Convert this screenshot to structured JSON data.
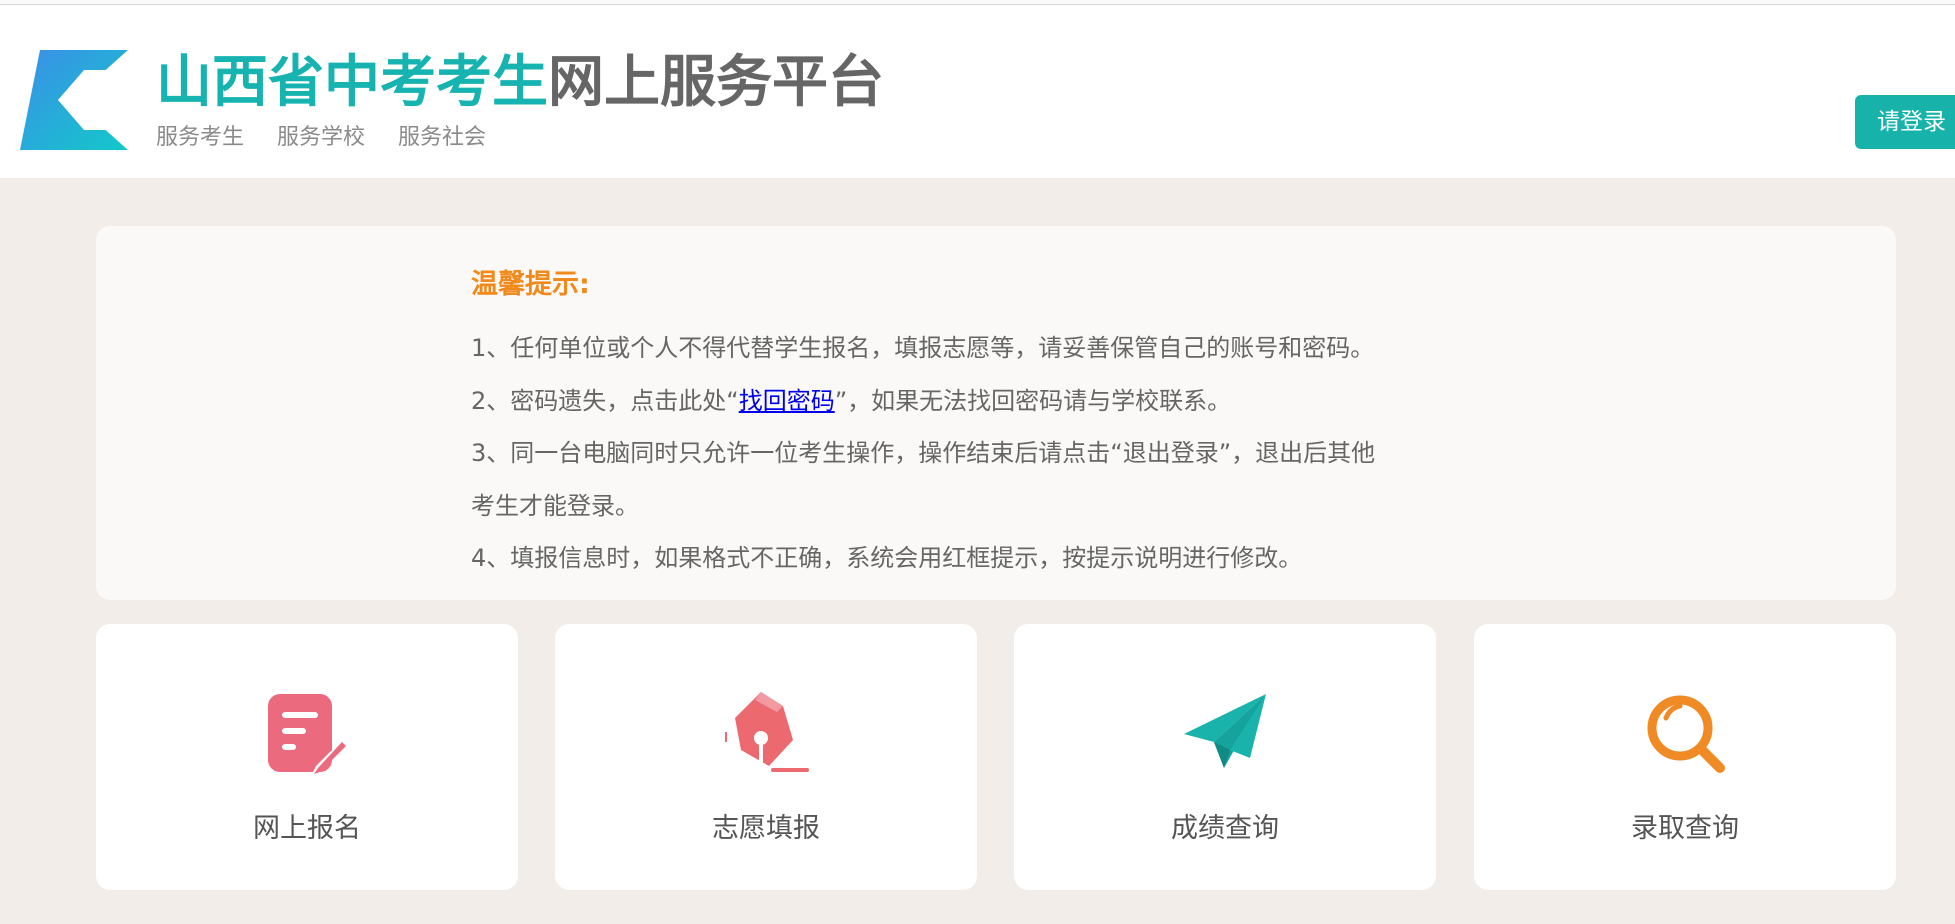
{
  "header": {
    "title_highlight": "山西省中考考生",
    "title_rest": "网上服务平台",
    "slogans": [
      "服务考生",
      "服务学校",
      "服务社会"
    ],
    "login_label": "请登录"
  },
  "notice": {
    "title": "温馨提示:",
    "line1": "1、任何单位或个人不得代替学生报名，填报志愿等，请妥善保管自己的账号和密码。",
    "line2_prefix": "2、密码遗失，点击此处“",
    "line2_link": "找回密码",
    "line2_suffix": "”，如果无法找回密码请与学校联系。",
    "line3": "3、同一台电脑同时只允许一位考生操作，操作结束后请点击“退出登录”，退出后其他",
    "line3_cont": "考生才能登录。",
    "line4": "4、填报信息时，如果格式不正确，系统会用红框提示，按提示说明进行修改。"
  },
  "cards": [
    {
      "label": "网上报名",
      "icon": "registration-form-icon",
      "color": "#ec6a7d"
    },
    {
      "label": "志愿填报",
      "icon": "fountain-pen-icon",
      "color": "#ec6a6f"
    },
    {
      "label": "成绩查询",
      "icon": "paper-plane-icon",
      "color": "#19b3ac"
    },
    {
      "label": "录取查询",
      "icon": "magnifier-icon",
      "color": "#f08a24"
    }
  ],
  "colors": {
    "brand": "#17b3b0",
    "notice_title": "#f08a1c",
    "background": "#f2ede8"
  }
}
